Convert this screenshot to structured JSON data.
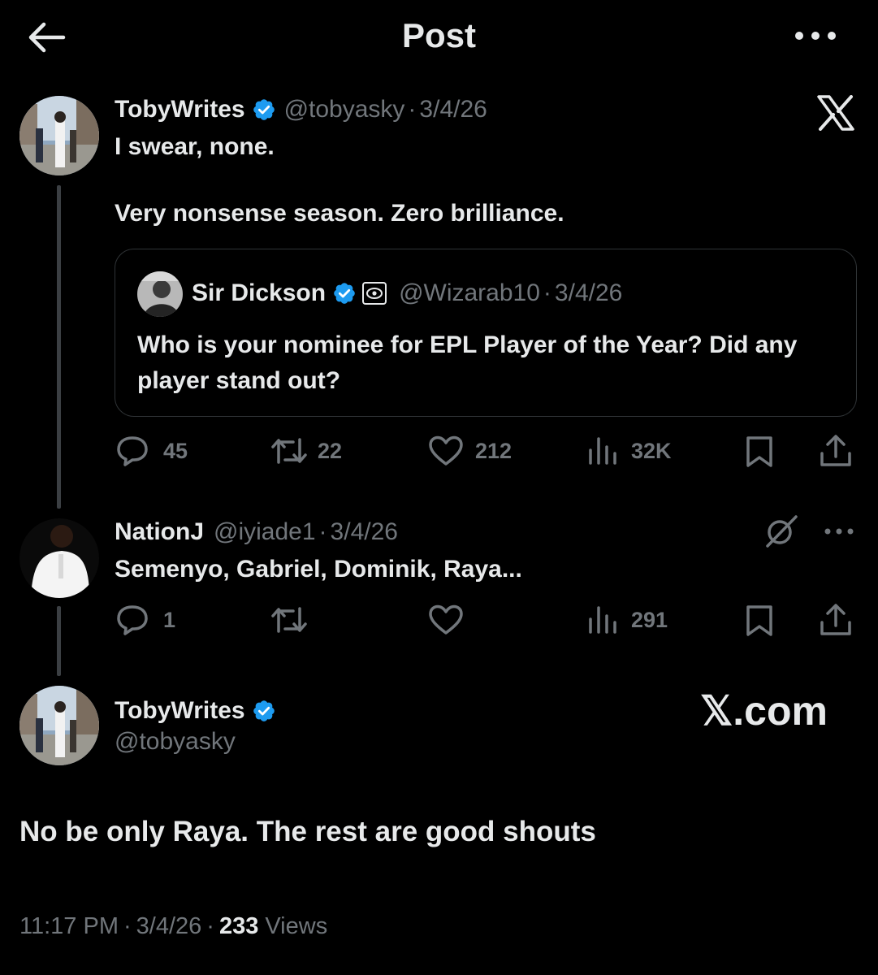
{
  "header": {
    "title": "Post"
  },
  "thread": [
    {
      "display_name": "TobyWrites",
      "handle": "@tobyasky",
      "sep": "·",
      "date": "3/4/26",
      "line1": "I swear, none.",
      "line2": "Very nonsense season. Zero brilliance.",
      "quote": {
        "display_name": "Sir Dickson",
        "handle": "@Wizarab10",
        "sep": "·",
        "date": "3/4/26",
        "text": "Who is your nominee for EPL Player of the Year? Did any player stand out?"
      },
      "actions": {
        "replies": "45",
        "reposts": "22",
        "likes": "212",
        "views": "32K"
      }
    },
    {
      "display_name": "NationJ",
      "handle": "@iyiade1",
      "sep": "·",
      "date": "3/4/26",
      "text": "Semenyo, Gabriel, Dominik, Raya...",
      "actions": {
        "replies": "1",
        "views": "291"
      }
    }
  ],
  "main_post": {
    "display_name": "TobyWrites",
    "handle": "@tobyasky",
    "watermark": "𝕏.com",
    "text": "No be only Raya. The rest are good shouts",
    "time": "11:17 PM",
    "sep1": "·",
    "date": "3/4/26",
    "sep2": "·",
    "views_count": "233",
    "views_label": "Views"
  },
  "icons": {
    "back": "back-arrow-icon",
    "more": "more-icon",
    "x_logo": "x-logo-icon",
    "verified": "verified-badge-icon",
    "reply": "reply-icon",
    "repost": "repost-icon",
    "like": "like-icon",
    "views": "views-icon",
    "bookmark": "bookmark-icon",
    "share": "share-icon"
  },
  "colors": {
    "background": "#000000",
    "text": "#e7e9ea",
    "muted": "#71767b",
    "verified": "#1d9bf0",
    "border": "#2f3336"
  }
}
